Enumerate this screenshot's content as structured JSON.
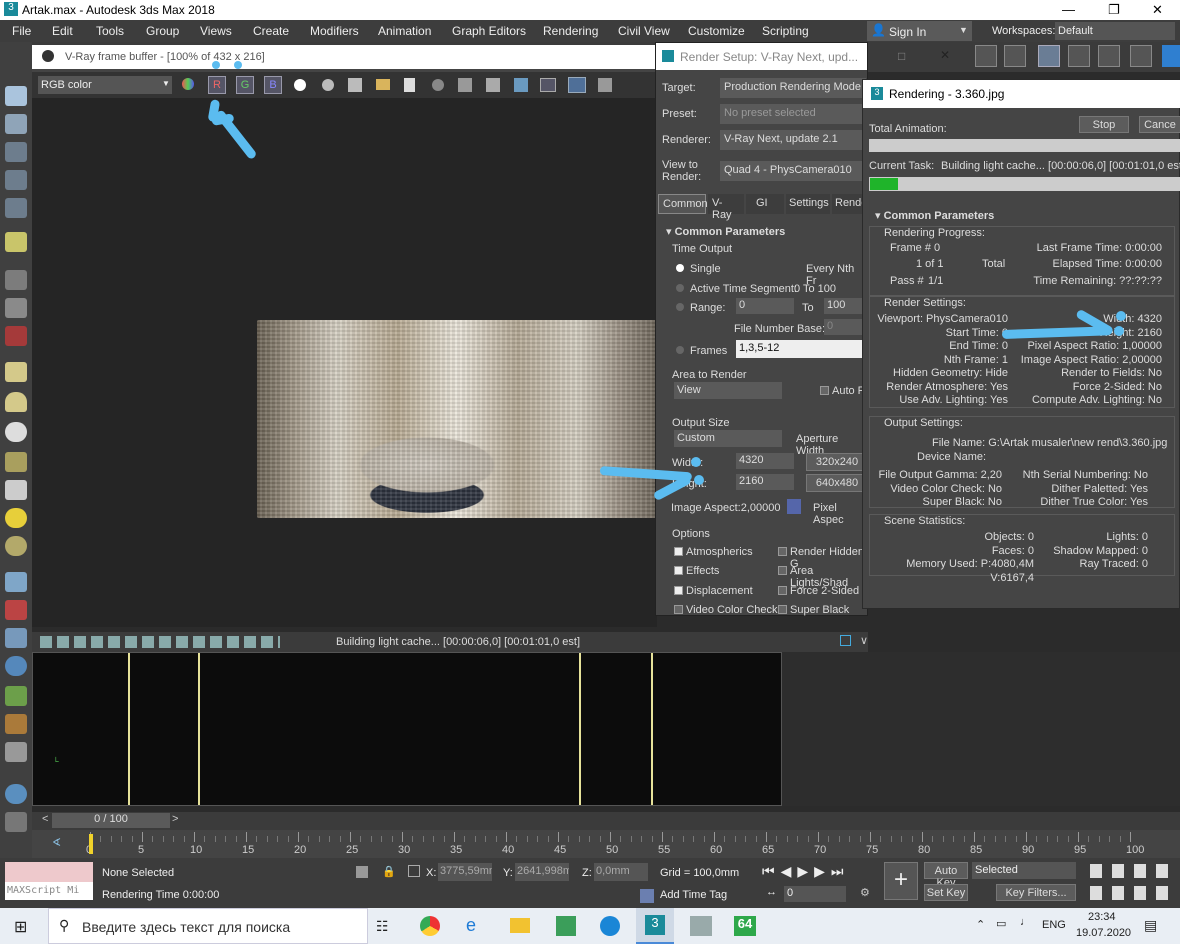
{
  "window": {
    "title": "Artak.max - Autodesk 3ds Max 2018"
  },
  "menu": [
    "File",
    "Edit",
    "Tools",
    "Group",
    "Views",
    "Create",
    "Modifiers",
    "Animation",
    "Graph Editors",
    "Rendering",
    "Civil View",
    "Customize",
    "Scripting"
  ],
  "account": {
    "sign_in": "Sign In",
    "workspaces_label": "Workspaces:",
    "workspace": "Default"
  },
  "vfb": {
    "title": "V-Ray frame buffer - [100% of 432 x 216]",
    "channel": "RGB color",
    "channel_buttons": [
      "R",
      "G",
      "B"
    ]
  },
  "render_setup": {
    "title": "Render Setup: V-Ray Next, upd...",
    "target_label": "Target:",
    "target": "Production Rendering Mode",
    "preset_label": "Preset:",
    "preset": "No preset selected",
    "renderer_label": "Renderer:",
    "renderer": "V-Ray Next, update 2.1",
    "view_label": "View to Render:",
    "view": "Quad 4 - PhysCamera010",
    "tabs": [
      "Common",
      "V-Ray",
      "GI",
      "Settings",
      "Rende"
    ],
    "rollout": "Common Parameters",
    "time_output": "Time Output",
    "single": "Single",
    "every_nth": "Every Nth Fr",
    "active_segment": "Active Time Segment:",
    "active_range": "0 To 100",
    "range": "Range:",
    "range_from": "0",
    "range_to_label": "To",
    "range_to": "100",
    "file_number_base": "File Number Base:",
    "file_number_value": "0",
    "frames": "Frames",
    "frames_value": "1,3,5-12",
    "area_to_render": "Area to Render",
    "area_value": "View",
    "auto_region": "Auto R",
    "output_size": "Output Size",
    "output_preset": "Custom",
    "aperture": "Aperture Width",
    "width_label": "Width:",
    "width": "4320",
    "height_label": "Height:",
    "height": "2160",
    "size_btns": [
      "320x240",
      "640x480"
    ],
    "image_aspect": "Image Aspect:2,00000",
    "pixel_aspect": "Pixel Aspec",
    "options": "Options",
    "opts_left": [
      "Atmospherics",
      "Effects",
      "Displacement",
      "Video Color Check"
    ],
    "opts_right": [
      "Render Hidden G",
      "Area Lights/Shad",
      "Force 2-Sided",
      "Super Black"
    ]
  },
  "rendering": {
    "title": "Rendering - 3.360.jpg",
    "total_animation": "Total Animation:",
    "stop": "Stop",
    "cancel": "Cance",
    "current_task_label": "Current Task:",
    "current_task": "Building light cache... [00:00:06,0] [00:01:01,0 est]",
    "progress": 0.09,
    "common_params": "Common Parameters",
    "rendering_progress": "Rendering Progress:",
    "frame_label": "Frame #",
    "frame_value": "0",
    "of": "1 of 1",
    "total": "Total",
    "pass_label": "Pass #",
    "pass_value": "1/1",
    "last_frame": "Last Frame Time:  0:00:00",
    "elapsed": "Elapsed Time:  0:00:00",
    "remaining": "Time Remaining: ??:??:??",
    "render_settings": "Render Settings:",
    "rs_left": [
      "Viewport:  PhysCamera010",
      "Start Time:  0",
      "End Time:  0",
      "Nth Frame:  1",
      "Hidden Geometry:  Hide",
      "Render Atmosphere:  Yes",
      "Use Adv. Lighting:  Yes"
    ],
    "rs_right": [
      "Width:  4320",
      "Height:  2160",
      "Pixel Aspect Ratio:  1,00000",
      "Image Aspect Ratio:  2,00000",
      "Render to Fields:  No",
      "Force 2-Sided:  No",
      "Compute Adv. Lighting:  No"
    ],
    "output_settings": "Output Settings:",
    "file_name": "File Name:  G:\\Artak musaler\\new rend\\3.360.jpg",
    "device_name": "Device Name:",
    "os_left": [
      "File Output Gamma:  2,20",
      "Video Color Check:  No",
      "Super Black:  No"
    ],
    "os_right": [
      "Nth Serial Numbering:  No",
      "Dither Paletted:  Yes",
      "Dither True Color:  Yes"
    ],
    "scene_stats": "Scene Statistics:",
    "ss_left": [
      "Objects:  0",
      "Faces:  0",
      "Memory Used:  P:4080,4M V:6167,4"
    ],
    "ss_right": [
      "Lights:  0",
      "Shadow Mapped:  0",
      "Ray Traced:  0"
    ]
  },
  "timeline": {
    "status": "Building light cache... [00:00:06,0] [00:01:01,0 est]",
    "slider": "0 / 100",
    "ticks": [
      "0",
      "5",
      "10",
      "15",
      "20",
      "25",
      "30",
      "35",
      "40",
      "45",
      "50",
      "55",
      "60",
      "65",
      "70",
      "75",
      "80",
      "85",
      "90",
      "95",
      "100"
    ]
  },
  "status": {
    "selection": "None Selected",
    "render_time": "Rendering Time  0:00:00",
    "maxscript": "MAXScript Mi",
    "x_label": "X:",
    "x": "3775,59mm",
    "y_label": "Y:",
    "y": "2641,998m",
    "z_label": "Z:",
    "z": "0,0mm",
    "grid": "Grid = 100,0mm",
    "add_time_tag": "Add Time Tag",
    "auto_key": "Auto Key",
    "selected": "Selected",
    "set_key": "Set Key",
    "key_filters": "Key Filters...",
    "frame": "0"
  },
  "taskbar": {
    "search": "Введите здесь текст для поиска",
    "lang": "ENG",
    "time": "23:34",
    "date": "19.07.2020",
    "badge": "64"
  }
}
